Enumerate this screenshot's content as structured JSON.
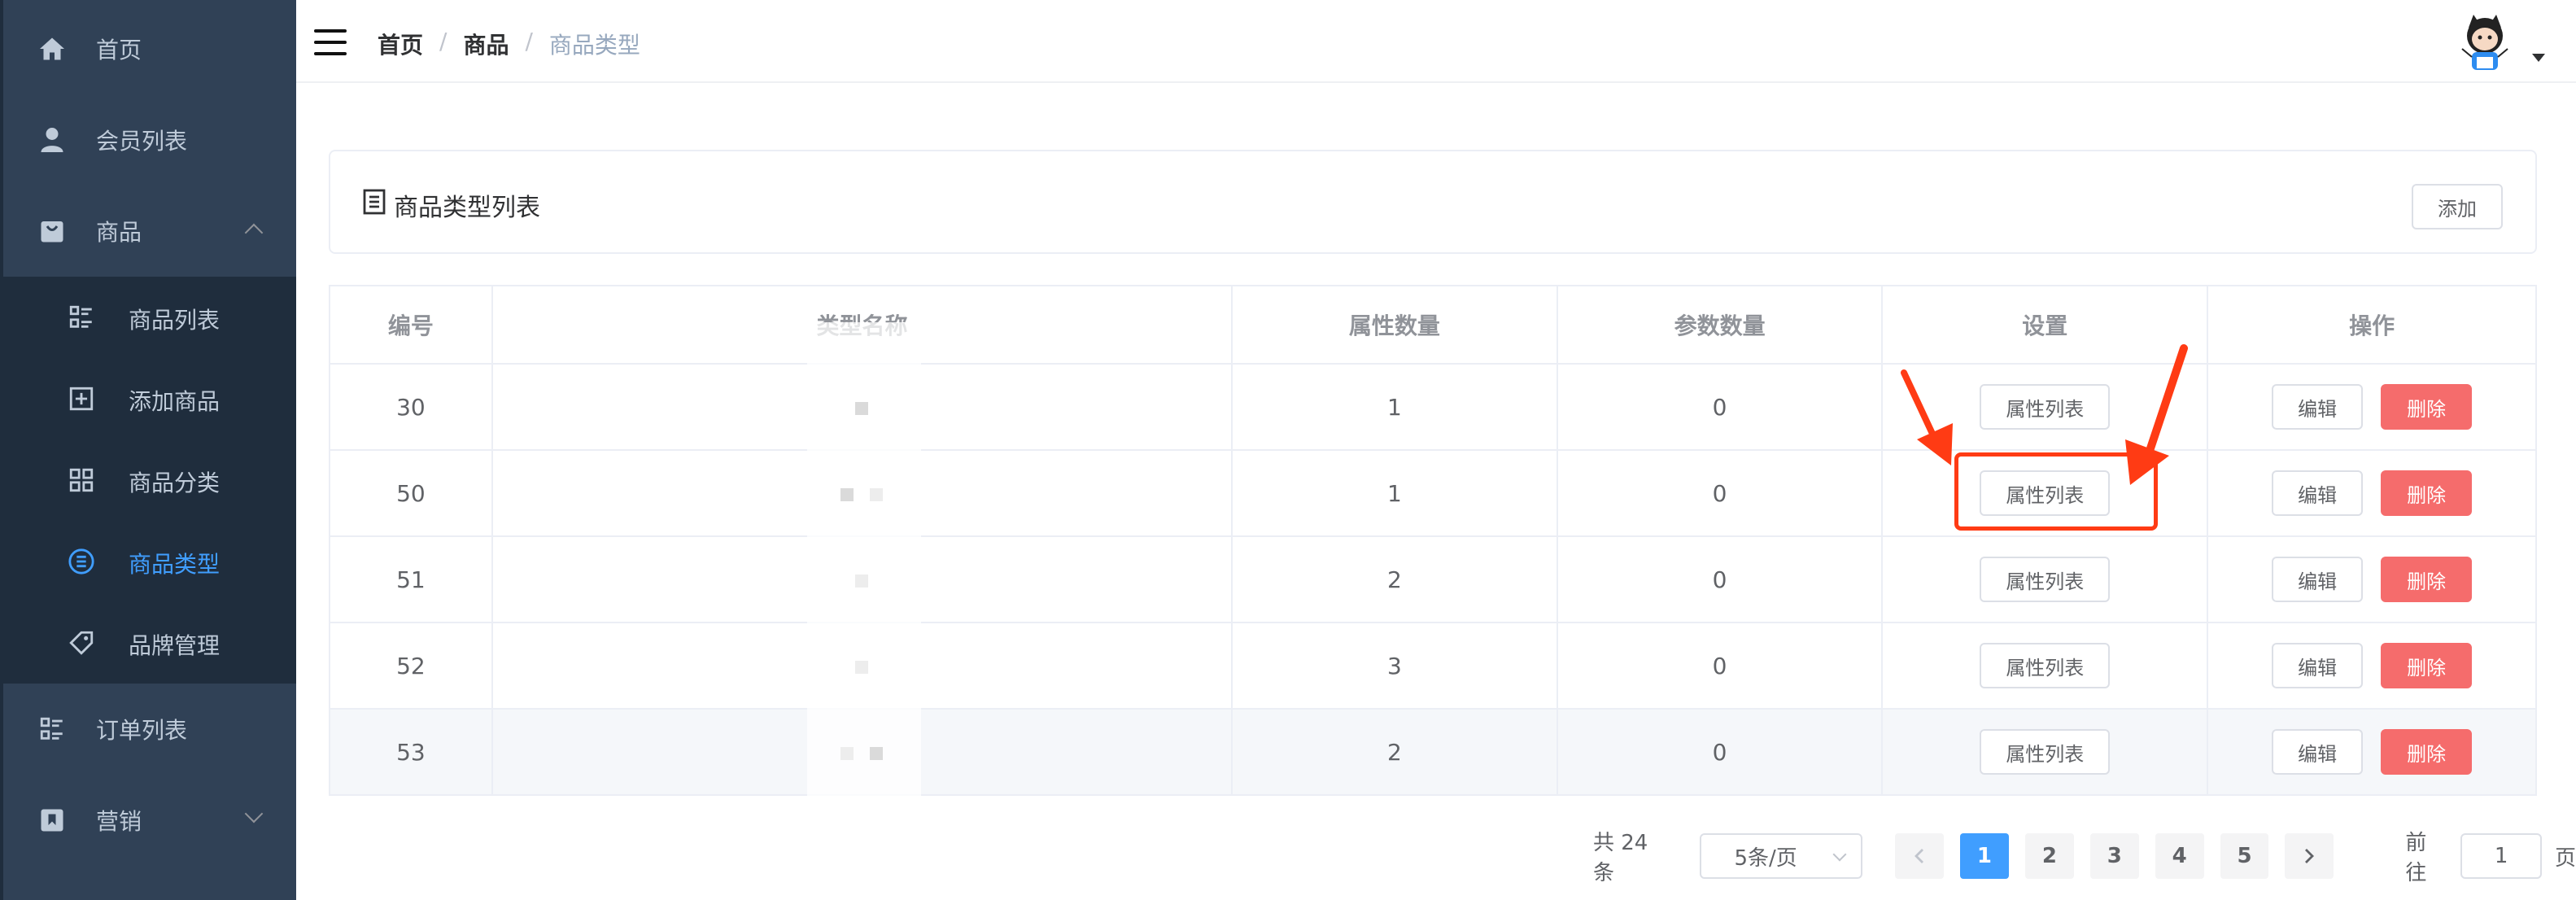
{
  "sidebar": {
    "items": [
      {
        "label": "首页",
        "icon": "home-icon"
      },
      {
        "label": "会员列表",
        "icon": "user-icon"
      },
      {
        "label": "商品",
        "icon": "shopping-bag-icon",
        "expanded": true
      },
      {
        "label": "订单列表",
        "icon": "list-icon"
      },
      {
        "label": "营销",
        "icon": "bookmark-icon",
        "expanded": false
      }
    ],
    "submenu": [
      {
        "label": "商品列表",
        "icon": "list-icon"
      },
      {
        "label": "添加商品",
        "icon": "plus-square-icon"
      },
      {
        "label": "商品分类",
        "icon": "grid-icon"
      },
      {
        "label": "商品类型",
        "icon": "list-circle-icon",
        "active": true
      },
      {
        "label": "品牌管理",
        "icon": "tag-icon"
      }
    ]
  },
  "header": {
    "breadcrumb": [
      "首页",
      "商品",
      "商品类型"
    ]
  },
  "card": {
    "title": "商品类型列表",
    "add_label": "添加"
  },
  "table": {
    "headers": [
      "编号",
      "类型名称",
      "属性数量",
      "参数数量",
      "设置",
      "操作"
    ],
    "rows": [
      {
        "id": "30",
        "attr_count": "1",
        "param_count": "0"
      },
      {
        "id": "50",
        "attr_count": "1",
        "param_count": "0"
      },
      {
        "id": "51",
        "attr_count": "2",
        "param_count": "0"
      },
      {
        "id": "52",
        "attr_count": "3",
        "param_count": "0"
      },
      {
        "id": "53",
        "attr_count": "2",
        "param_count": "0"
      }
    ],
    "attr_button": "属性列表",
    "edit_button": "编辑",
    "delete_button": "删除"
  },
  "pagination": {
    "total": "共 24 条",
    "page_size": "5条/页",
    "pages": [
      "1",
      "2",
      "3",
      "4",
      "5"
    ],
    "current": "1",
    "goto_prefix": "前往",
    "goto_value": "1",
    "goto_suffix": "页"
  },
  "colors": {
    "sidebar_bg": "#304156",
    "submenu_bg": "#1f2d3d",
    "active": "#409eff",
    "danger": "#f56c6c",
    "annotation": "#ff3b14"
  }
}
